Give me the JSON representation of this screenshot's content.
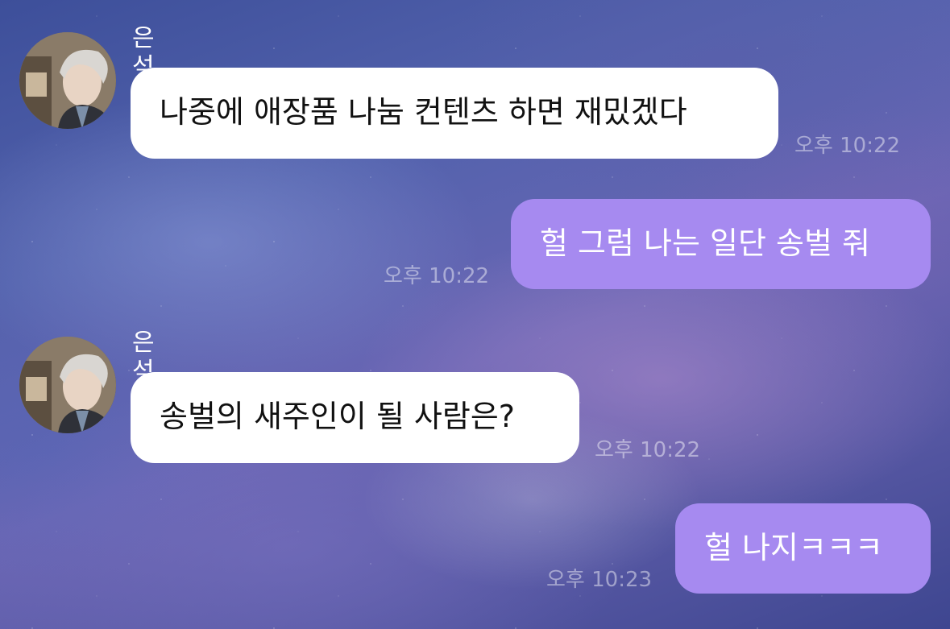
{
  "messages": [
    {
      "sender": "은석",
      "direction": "incoming",
      "text": "나중에 애장품 나눔 컨텐츠 하면 재밌겠다",
      "time": "오후 10:22"
    },
    {
      "direction": "outgoing",
      "text": "헐 그럼 나는 일단 송벌 줘",
      "time": "오후 10:22"
    },
    {
      "sender": "은석",
      "direction": "incoming",
      "text": "송벌의 새주인이 될 사람은?",
      "time": "오후 10:22"
    },
    {
      "direction": "outgoing",
      "text": "헐 나지ㅋㅋㅋ",
      "time": "오후 10:23"
    }
  ],
  "colors": {
    "incoming_bubble": "#ffffff",
    "outgoing_bubble": "#a68af0",
    "timestamp": "#ffffff"
  }
}
